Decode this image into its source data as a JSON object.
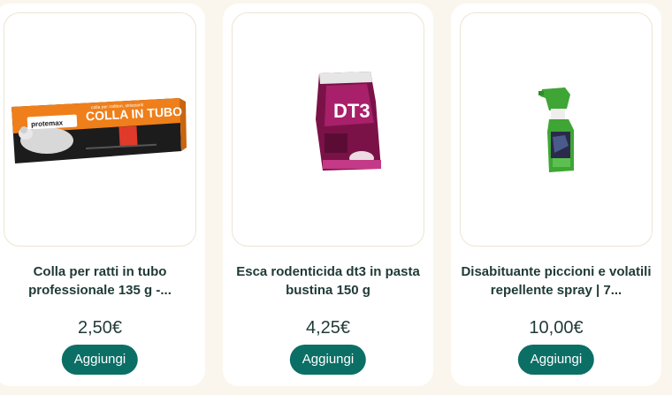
{
  "products": [
    {
      "name": "Colla per ratti in tubo professionale 135 g -...",
      "price": "2,50€",
      "button_label": "Aggiungi",
      "image": {
        "brand_text": "protemax",
        "product_text": "COLLA IN TUBO",
        "sub_text": "colla per roditori, striscianti",
        "colors": {
          "primary": "#ef7f1a",
          "secondary": "#1b1b1b"
        }
      }
    },
    {
      "name": "Esca rodenticida dt3 in pasta bustina 150 g",
      "price": "4,25€",
      "button_label": "Aggiungi",
      "image": {
        "brand_text": "DT3",
        "colors": {
          "primary": "#8a1a55",
          "secondary": "#c43a86"
        }
      }
    },
    {
      "name": "Disabituante piccioni e volatili repellente spray | 7...",
      "price": "10,00€",
      "button_label": "Aggiungi",
      "image": {
        "colors": {
          "primary": "#3fa535",
          "secondary": "#2a2a4a"
        }
      }
    }
  ],
  "theme": {
    "accent": "#0c6f66",
    "background": "#faf6ed",
    "text": "#1f3a36"
  }
}
